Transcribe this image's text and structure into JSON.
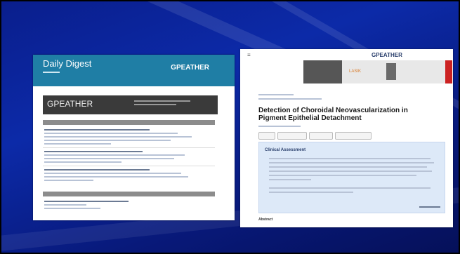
{
  "digest": {
    "title": "Daily Digest",
    "logo": "GPEATHER",
    "banner_brand": "GPEATHER",
    "section_1": "",
    "section_2": ""
  },
  "article": {
    "menu_icon": "hamburger-icon",
    "logo": "GPEATHER",
    "ad_text_1": "LASIK",
    "ad_text_2": "",
    "title": "Detection of Choroidal Neovascularization in Pigment Epithelial Detachment",
    "buttons": [
      "",
      "",
      "",
      ""
    ],
    "box_title": "Clinical Assessment",
    "section_label": "Abstract"
  },
  "colors": {
    "background": "#0c2aa8",
    "digest_header": "#1f7ea5",
    "box": "#dde9f8"
  }
}
